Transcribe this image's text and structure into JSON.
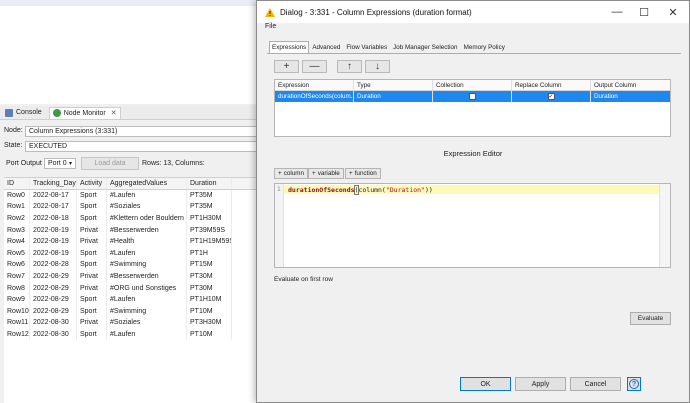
{
  "workbench": {
    "tabs": [
      {
        "label": "Console",
        "icon": "console-icon"
      },
      {
        "label": "Node Monitor",
        "icon": "monitor-icon"
      }
    ],
    "close_glyph": "✕",
    "node_label": "Node:",
    "node_value": "Column Expressions  (3:331)",
    "state_label": "State:",
    "state_value": "EXECUTED",
    "port_output_label": "Port Output",
    "port_value": "Port 0",
    "load_data_label": "Load data",
    "rows_info": "Rows: 13, Columns:",
    "table": {
      "headers": [
        "ID",
        "Tracking_Day",
        "Activity",
        "AggregatedValues",
        "Duration"
      ],
      "rows": [
        [
          "Row0",
          "2022-08-17",
          "Sport",
          "#Laufen",
          "PT35M"
        ],
        [
          "Row1",
          "2022-08-17",
          "Sport",
          "#Soziales",
          "PT35M"
        ],
        [
          "Row2",
          "2022-08-18",
          "Sport",
          "#Klettern oder Bouldern",
          "PT1H30M"
        ],
        [
          "Row3",
          "2022-08-19",
          "Privat",
          "#Besserwerden",
          "PT39M59S"
        ],
        [
          "Row4",
          "2022-08-19",
          "Privat",
          "#Health",
          "PT1H19M59S"
        ],
        [
          "Row5",
          "2022-08-19",
          "Sport",
          "#Laufen",
          "PT1H"
        ],
        [
          "Row6",
          "2022-08-28",
          "Sport",
          "#Swimming",
          "PT15M"
        ],
        [
          "Row7",
          "2022-08-29",
          "Privat",
          "#Besserwerden",
          "PT30M"
        ],
        [
          "Row8",
          "2022-08-29",
          "Privat",
          "#ORG und Sonstiges",
          "PT30M"
        ],
        [
          "Row9",
          "2022-08-29",
          "Sport",
          "#Laufen",
          "PT1H10M"
        ],
        [
          "Row10",
          "2022-08-29",
          "Sport",
          "#Swimming",
          "PT10M"
        ],
        [
          "Row11",
          "2022-08-30",
          "Privat",
          "#Soziales",
          "PT3H30M"
        ],
        [
          "Row12",
          "2022-08-30",
          "Sport",
          "#Laufen",
          "PT10M"
        ]
      ]
    }
  },
  "dialog": {
    "title": "Dialog - 3:331 - Column Expressions (duration format)",
    "minimize": "—",
    "maximize": "☐",
    "close": "✕",
    "menu_file": "File",
    "tabs": [
      "Expressions",
      "Advanced",
      "Flow Variables",
      "Job Manager Selection",
      "Memory Policy"
    ],
    "toolbar": {
      "add": "+",
      "remove": "—",
      "up": "↑",
      "down": "↓"
    },
    "grid": {
      "headers": [
        "Expression",
        "Type",
        "Collection",
        "Replace Column",
        "Output Column"
      ],
      "row": {
        "expression": "durationOfSeconds(colum...",
        "type": "Duration",
        "collection_checked": false,
        "replace_checked": true,
        "check_glyph": "✓",
        "output": "Duration"
      }
    },
    "expression_editor_label": "Expression Editor",
    "insert_buttons": [
      "column",
      "variable",
      "function"
    ],
    "code": {
      "line_number": "1",
      "fn": "durationOfSeconds",
      "open": "(",
      "mid": "column(",
      "arg": "\"Duration\"",
      "close": "))"
    },
    "evaluate_first_row": "Evaluate on first row",
    "evaluate_button": "Evaluate",
    "footer": {
      "ok": "OK",
      "apply": "Apply",
      "cancel": "Cancel",
      "help": "?"
    },
    "colors": {
      "accent": "#1e88f0",
      "warning": "#f0b400"
    }
  }
}
